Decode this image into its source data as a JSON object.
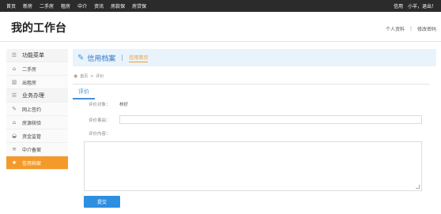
{
  "topbar": {
    "nav": [
      "首页",
      "新房",
      "二手房",
      "租房",
      "中介",
      "资讯",
      "房款保",
      "房贷保"
    ],
    "user_name": "信用",
    "user_greeting": "小羊，退出！"
  },
  "header": {
    "title": "我的工作台",
    "links": [
      "个人资料",
      "修改密码"
    ]
  },
  "sidebar": {
    "items": [
      {
        "label": "功能菜单",
        "icon": "menu-icon",
        "kind": "group"
      },
      {
        "label": "二手房",
        "icon": "house-icon",
        "kind": "item"
      },
      {
        "label": "出租房",
        "icon": "building-icon",
        "kind": "item"
      },
      {
        "label": "业务办理",
        "icon": "list-icon",
        "kind": "group"
      },
      {
        "label": "网上签约",
        "icon": "edit-icon",
        "kind": "item"
      },
      {
        "label": "房源核验",
        "icon": "house-check-icon",
        "kind": "item"
      },
      {
        "label": "资金监管",
        "icon": "lock-icon",
        "kind": "item"
      },
      {
        "label": "中介备案",
        "icon": "layers-icon",
        "kind": "item"
      },
      {
        "label": "信用档案",
        "icon": "star-icon",
        "kind": "item",
        "active": true
      }
    ]
  },
  "main": {
    "section_title": "信用档案",
    "section_tab": "信用首页",
    "breadcrumb": [
      "首页",
      "评价"
    ],
    "panel_tab": "评价",
    "form": {
      "target_label": "评价对象：",
      "target_value": "林好",
      "reason_label": "评价事由：",
      "reason_value": "",
      "content_label": "评价内容：",
      "content_value": ""
    },
    "submit_label": "提交"
  },
  "colors": {
    "topbar_bg": "#2b2b2b",
    "accent_orange": "#f39a2b",
    "accent_blue": "#2d8fe0",
    "section_bg": "#e9f3fb"
  }
}
